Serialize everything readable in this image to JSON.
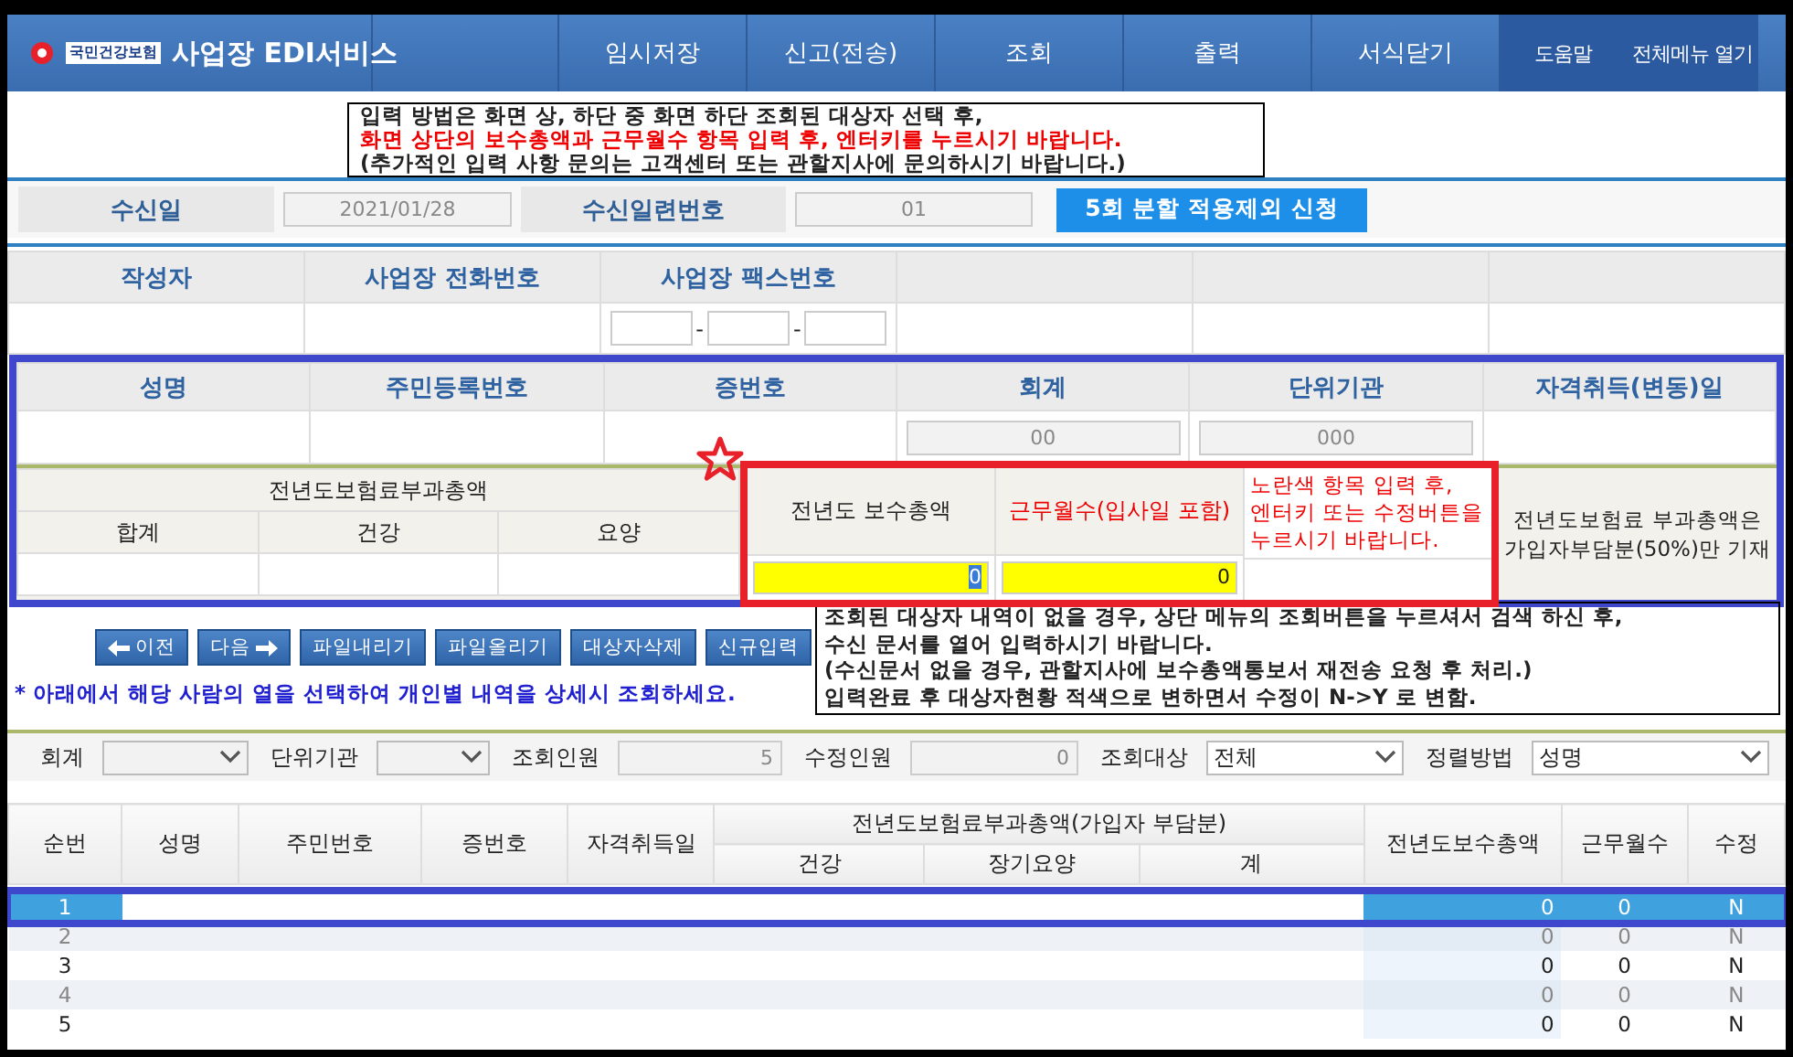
{
  "header": {
    "logo_text": "국민건강보험",
    "title": "사업장 EDI서비스",
    "menu": [
      {
        "label": "임시저장",
        "kind": "main"
      },
      {
        "label": "신고(전송)",
        "kind": "main"
      },
      {
        "label": "조회",
        "kind": "main"
      },
      {
        "label": "출력",
        "kind": "main"
      },
      {
        "label": "서식닫기",
        "kind": "main"
      },
      {
        "label": "도움말",
        "kind": "side"
      },
      {
        "label": "전체메뉴 열기",
        "kind": "side"
      }
    ]
  },
  "notice": {
    "lines": [
      {
        "text": "입력 방법은 화면 상, 하단 중 화면 하단 조회된 대상자 선택 후,",
        "kind": "normal"
      },
      {
        "text": "화면 상단의 보수총액과 근무월수 항목 입력 후, 엔터키를 누르시기 바랍니다.",
        "kind": "alert"
      },
      {
        "text": "(추가적인 입력 사항 문의는 고객센터 또는 관할지사에 문의하시기 바랍니다.)",
        "kind": "normal"
      }
    ]
  },
  "receipt": {
    "fields": [
      {
        "label": "수신일",
        "value": "2021/01/28"
      },
      {
        "label": "수신일련번호",
        "value": "01"
      }
    ],
    "button": "5회 분할 적용제외 신청"
  },
  "workplace": {
    "columns": [
      {
        "label": "작성자",
        "kind": "text"
      },
      {
        "label": "사업장 전화번호",
        "kind": "text"
      },
      {
        "label": "사업장 팩스번호",
        "kind": "fax",
        "separators": [
          "-",
          "-"
        ]
      }
    ]
  },
  "person": {
    "columns": [
      {
        "label": "성명",
        "kind": "text"
      },
      {
        "label": "주민등록번호",
        "kind": "text"
      },
      {
        "label": "증번호",
        "kind": "text"
      },
      {
        "label": "회계",
        "kind": "input",
        "value": "00"
      },
      {
        "label": "단위기관",
        "kind": "input",
        "value": "000"
      },
      {
        "label": "자격취득(변동)일",
        "kind": "text"
      }
    ]
  },
  "premium": {
    "title": "전년도보험료부과총액",
    "columns": [
      "합계",
      "건강",
      "요양"
    ],
    "inputs": [
      {
        "label": "전년도 보수총액",
        "alert": false,
        "value": "0",
        "selected": true
      },
      {
        "label": "근무월수(입사일 포함)",
        "alert": true,
        "value": "0",
        "selected": false
      }
    ],
    "hint": [
      "노란색 항목 입력 후,",
      "엔터키 또는 수정버튼을",
      "누르시기 바랍니다."
    ],
    "note": [
      "전년도보험료 부과총액은",
      "가입자부담분(50%)만 기재"
    ]
  },
  "buttons": [
    {
      "label": "이전",
      "kind": "prev"
    },
    {
      "label": "다음",
      "kind": "next"
    },
    {
      "label": "파일내리기",
      "kind": "plain"
    },
    {
      "label": "파일올리기",
      "kind": "plain"
    },
    {
      "label": "대상자삭제",
      "kind": "plain"
    },
    {
      "label": "신규입력",
      "kind": "plain"
    }
  ],
  "select_hint": "* 아래에서 해당 사람의 열을 선택하여 개인별 내역을 상세시 조회하세요.",
  "guide": {
    "lines": [
      "조회된 대상자 내역이 없을 경우, 상단 메뉴의 조회버튼을 누르셔서 검색 하신 후,",
      "수신 문서를 열어 입력하시기 바랍니다.",
      "(수신문서 없을 경우, 관할지사에 보수총액통보서 재전송 요청 후 처리.)",
      "입력완료 후 대상자현황 적색으로 변하면서 수정이 N->Y 로 변함."
    ]
  },
  "filters": [
    {
      "label": "회계",
      "kind": "select"
    },
    {
      "label": "단위기관",
      "kind": "select"
    },
    {
      "label": "조회인원",
      "kind": "number",
      "value": "5"
    },
    {
      "label": "수정인원",
      "kind": "number",
      "value": "0"
    },
    {
      "label": "조회대상",
      "kind": "select",
      "value": "전체"
    },
    {
      "label": "정렬방법",
      "kind": "select",
      "value": "성명"
    }
  ],
  "grid": {
    "columns": [
      {
        "label": "순번"
      },
      {
        "label": "성명"
      },
      {
        "label": "주민번호"
      },
      {
        "label": "증번호"
      },
      {
        "label": "자격취득일"
      },
      {
        "label": "전년도보험료부과총액(가입자 부담분)",
        "children": [
          {
            "label": "건강"
          },
          {
            "label": "장기요양"
          },
          {
            "label": "계"
          }
        ]
      },
      {
        "label": "전년도보수총액"
      },
      {
        "label": "근무월수"
      },
      {
        "label": "수정"
      }
    ],
    "rows": [
      {
        "no": "1",
        "salary": "0",
        "months": "0",
        "edited": "N",
        "selected": true
      },
      {
        "no": "2",
        "salary": "0",
        "months": "0",
        "edited": "N",
        "selected": false
      },
      {
        "no": "3",
        "salary": "0",
        "months": "0",
        "edited": "N",
        "selected": false
      },
      {
        "no": "4",
        "salary": "0",
        "months": "0",
        "edited": "N",
        "selected": false
      },
      {
        "no": "5",
        "salary": "0",
        "months": "0",
        "edited": "N",
        "selected": false
      }
    ]
  }
}
